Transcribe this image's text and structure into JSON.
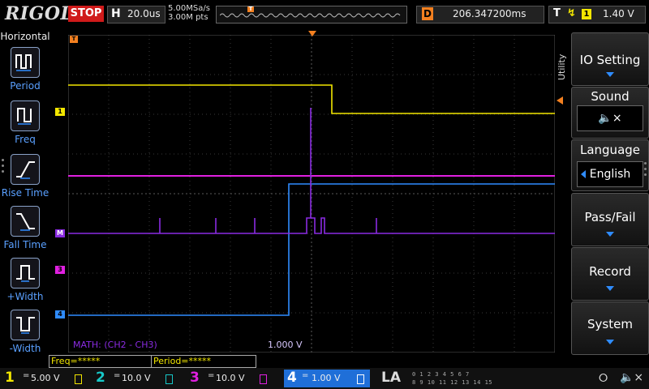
{
  "brand": "RIGOL",
  "run_state": "STOP",
  "timebase": {
    "key": "H",
    "value": "20.0us"
  },
  "acquisition": {
    "sample_rate": "5.00MSa/s",
    "points": "3.00M pts"
  },
  "trigger_marker": "T",
  "delay": {
    "key": "D",
    "value": "206.347200ms"
  },
  "trigger": {
    "key": "T",
    "edge_icon": "rising-edge-icon",
    "source": "1",
    "level": "1.40 V"
  },
  "left_panel": {
    "title": "Horizontal",
    "items": [
      {
        "label": "Period",
        "icon": "period-icon"
      },
      {
        "label": "Freq",
        "icon": "frequency-icon"
      },
      {
        "label": "Rise Time",
        "icon": "rise-time-icon"
      },
      {
        "label": "Fall Time",
        "icon": "fall-time-icon"
      },
      {
        "label": "+Width",
        "icon": "positive-width-icon"
      },
      {
        "label": "-Width",
        "icon": "negative-width-icon"
      }
    ]
  },
  "utility_label": "Utility",
  "menu": [
    {
      "label": "IO Setting"
    },
    {
      "label": "Sound",
      "value_icon": "speaker-muted-icon"
    },
    {
      "label": "Language",
      "value": "English"
    },
    {
      "label": "Pass/Fail"
    },
    {
      "label": "Record"
    },
    {
      "label": "System"
    }
  ],
  "markers": {
    "ch1": "1",
    "math": "M",
    "ch3": "3",
    "ch4": "4",
    "trigger": "T"
  },
  "math_label": "MATH: (CH2 - CH3)",
  "math_scale": "1.000 V",
  "counters": {
    "freq": "Freq=*****",
    "period": "Period=*****"
  },
  "channels": [
    {
      "num": "1",
      "coupling": "=",
      "scale": "5.00 V",
      "color": "#f2e600"
    },
    {
      "num": "2",
      "coupling": "=",
      "scale": "10.0 V",
      "color": "#17c8c8"
    },
    {
      "num": "3",
      "coupling": "=",
      "scale": "10.0 V",
      "color": "#e020e0"
    },
    {
      "num": "4",
      "coupling": "=",
      "scale": "1.00 V",
      "color": "#2f8cff"
    }
  ],
  "la": {
    "label": "LA",
    "row1": "0 1 2 3  4 5 6 7",
    "row2": "8 9 10 11  12 13 14 15"
  },
  "status_icons": {
    "usb": "usb-icon",
    "sound": "speaker-muted-icon"
  },
  "colors": {
    "ch1": "#f2e600",
    "ch3": "#e020e0",
    "ch4": "#2f8cff",
    "math": "#8a2be2",
    "trigger": "#f38020",
    "accent": "#2f8cff",
    "stop": "#d01a1a"
  }
}
